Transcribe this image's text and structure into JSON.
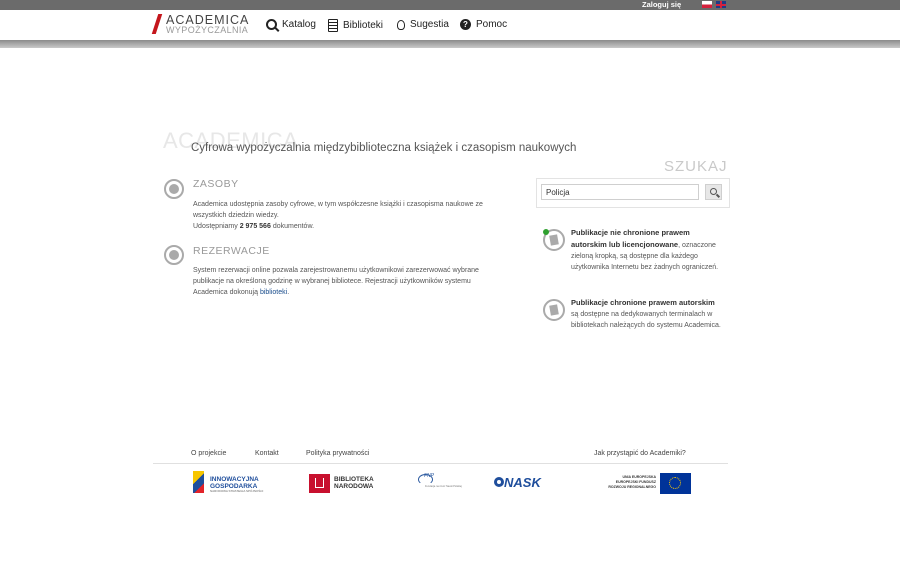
{
  "topbar": {
    "login_label": "Zaloguj się",
    "languages": [
      "pl-flag",
      "en-flag"
    ]
  },
  "logo": {
    "main": "ACADEMICA",
    "sub": "WYPOŻYCZALNIA"
  },
  "nav": [
    {
      "label": "Katalog",
      "icon": "search-icon"
    },
    {
      "label": "Biblioteki",
      "icon": "book-icon"
    },
    {
      "label": "Sugestia",
      "icon": "lightbulb-icon"
    },
    {
      "label": "Pomoc",
      "icon": "help-icon"
    }
  ],
  "hero": {
    "bg_title": "ACADEMICA",
    "tagline": "Cyfrowa wypożyczalnia międzybiblioteczna książek i czasopism naukowych"
  },
  "search": {
    "title": "SZUKAJ",
    "value": "Policja",
    "button_icon": "search-icon"
  },
  "sections": {
    "zasoby": {
      "title": "ZASOBY",
      "text1": "Academica udostępnia zasoby cyfrowe, w tym współczesne książki i czasopisma naukowe ze wszystkich dziedzin wiedzy.",
      "text2_prefix": "Udostępniamy",
      "count": "2 975 566",
      "text2_suffix": "dokumentów."
    },
    "rezerwacje": {
      "title": "REZERWACJE",
      "text": "System rezerwacji online pozwala zarejestrowanemu użytkownikowi zarezerwować wybrane publikacje na określoną godzinę w wybranej bibliotece. Rejestracji użytkowników systemu Academica dokonują",
      "link": "biblioteki",
      "suffix": "."
    }
  },
  "publications": {
    "free": {
      "bold": "Publikacje nie chronione prawem autorskim lub licencjonowane",
      "text": ", oznaczone zieloną kropką, są dostępne dla każdego użytkownika Internetu bez żadnych ograniczeń."
    },
    "protected": {
      "bold": "Publikacje chronione prawem autorskim",
      "text": " są dostępne na dedykowanych terminalach w bibliotekach należących do systemu Academica."
    }
  },
  "footer": {
    "links": [
      "O projekcie",
      "Kontakt",
      "Polityka prywatności"
    ],
    "join": "Jak przystąpić do Academiki?",
    "logos": {
      "ig": {
        "line1": "INNOWACYJNA",
        "line2": "GOSPODARKA",
        "small": "NARODOWA STRATEGIA SPÓJNOŚCI"
      },
      "bn": {
        "line1": "BIBLIOTEKA",
        "line2": "NARODOWA"
      },
      "fnp": {
        "mark": "FNP",
        "small": "Fundacja na rzecz Nauki Polskiej"
      },
      "nask": "NASK",
      "ue": {
        "line1": "UNIA EUROPEJSKA",
        "line2": "EUROPEJSKI FUNDUSZ",
        "line3": "ROZWOJU REGIONALNEGO"
      }
    }
  },
  "colors": {
    "accent": "#c4161c",
    "link": "#1a4d8c",
    "green_dot": "#2ea02e",
    "topbar": "#6b6b6b"
  }
}
